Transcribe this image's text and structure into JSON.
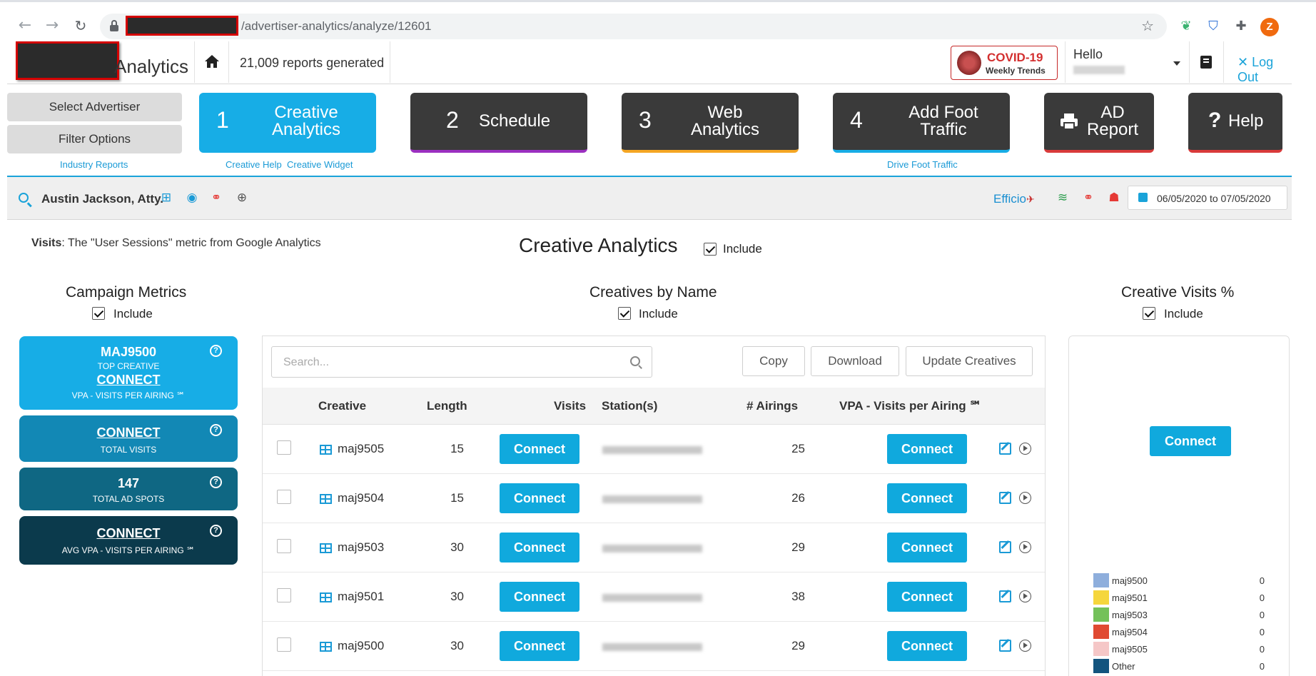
{
  "browser": {
    "url_path": "/advertiser-analytics/analyze/12601",
    "profile_initial": "Z"
  },
  "header": {
    "logo_suffix": "Analytics",
    "reports_generated": "21,009 reports generated",
    "covid_title": "COVID-19",
    "covid_subtitle": "Weekly Trends",
    "hello": "Hello",
    "logout": "Log Out"
  },
  "left_buttons": {
    "select_advertiser": "Select Advertiser",
    "filter_options": "Filter Options",
    "industry_reports": "Industry Reports"
  },
  "steps": [
    {
      "num": "1",
      "label": "Creative Analytics",
      "color": "#17ade6",
      "underline": "#17ade6"
    },
    {
      "num": "2",
      "label": "Schedule",
      "color": "#3a3a3a",
      "underline": "#9b30c0"
    },
    {
      "num": "3",
      "label": "Web Analytics",
      "color": "#3a3a3a",
      "underline": "#f5a623"
    },
    {
      "num": "4",
      "label": "Add Foot Traffic",
      "color": "#3a3a3a",
      "underline": "#17ade6"
    },
    {
      "num": "",
      "label": "AD Report",
      "color": "#3a3a3a",
      "underline": "#d93a3a"
    },
    {
      "num": "",
      "label": "Help",
      "color": "#3a3a3a",
      "underline": "#d93a3a"
    }
  ],
  "step_links": {
    "creative_help": "Creative Help",
    "creative_widget": "Creative Widget",
    "drive_foot_traffic": "Drive Foot Traffic"
  },
  "advertiser": {
    "name": "Austin Jackson, Atty.",
    "efficio": "Efficio",
    "date_range": "06/05/2020 to 07/05/2020"
  },
  "main": {
    "visits_label": "Visits",
    "visits_desc": ": The \"User Sessions\" metric from Google Analytics",
    "title": "Creative Analytics",
    "include": "Include"
  },
  "sections": {
    "campaign_metrics": "Campaign Metrics",
    "creatives_by_name": "Creatives by Name",
    "creative_visits": "Creative Visits %"
  },
  "metrics": [
    {
      "big": "MAJ9500",
      "sub": "TOP CREATIVE",
      "link": "CONNECT",
      "label": "VPA - VISITS PER AIRING ℠",
      "color": "#17ade6"
    },
    {
      "link": "CONNECT",
      "label": "TOTAL VISITS",
      "color": "#1288b5"
    },
    {
      "big": "147",
      "label": "TOTAL AD SPOTS",
      "color": "#0f6783"
    },
    {
      "link": "CONNECT",
      "label": "AVG VPA - VISITS PER AIRING ℠",
      "color": "#0b3a4c"
    }
  ],
  "table": {
    "search_placeholder": "Search...",
    "buttons": {
      "copy": "Copy",
      "download": "Download",
      "update": "Update Creatives"
    },
    "headers": {
      "creative": "Creative",
      "length": "Length",
      "visits": "Visits",
      "stations": "Station(s)",
      "airings": "# Airings",
      "vpa": "VPA - Visits per Airing ℠"
    },
    "connect": "Connect",
    "rows": [
      {
        "creative": "maj9505",
        "length": "15",
        "airings": "25"
      },
      {
        "creative": "maj9504",
        "length": "15",
        "airings": "26"
      },
      {
        "creative": "maj9503",
        "length": "30",
        "airings": "29"
      },
      {
        "creative": "maj9501",
        "length": "30",
        "airings": "38"
      },
      {
        "creative": "maj9500",
        "length": "30",
        "airings": "29"
      }
    ]
  },
  "visits_panel": {
    "connect": "Connect",
    "legend": [
      {
        "name": "maj9500",
        "value": "0",
        "color": "#8eaedc"
      },
      {
        "name": "maj9501",
        "value": "0",
        "color": "#f5d63d"
      },
      {
        "name": "maj9503",
        "value": "0",
        "color": "#74c15a"
      },
      {
        "name": "maj9504",
        "value": "0",
        "color": "#e04a32"
      },
      {
        "name": "maj9505",
        "value": "0",
        "color": "#f5c7c7"
      },
      {
        "name": "Other",
        "value": "0",
        "color": "#13547e"
      }
    ]
  }
}
